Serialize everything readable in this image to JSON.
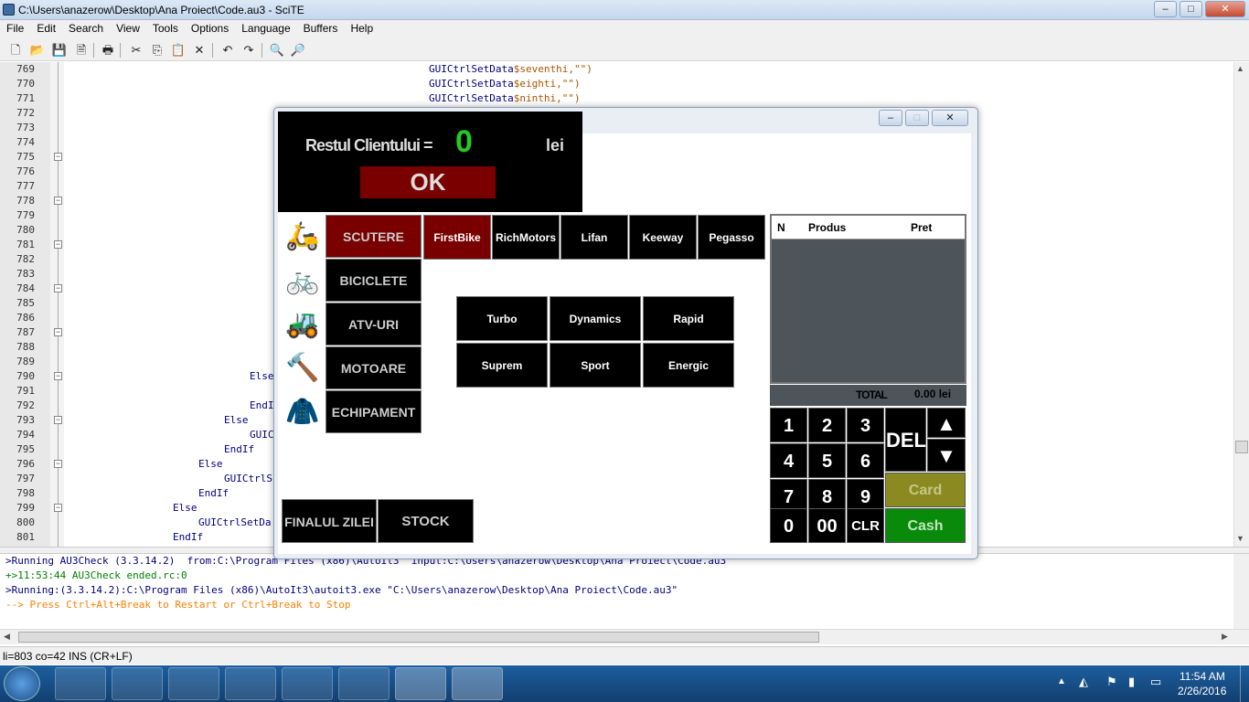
{
  "titlebar": {
    "title": "C:\\Users\\anazerow\\Desktop\\Ana Proiect\\Code.au3 - SciTE",
    "min": "‒",
    "max": "□",
    "close": "✕"
  },
  "menu": [
    "File",
    "Edit",
    "Search",
    "View",
    "Tools",
    "Options",
    "Language",
    "Buffers",
    "Help"
  ],
  "toolbar": {
    "icons": [
      "new-icon",
      "open-icon",
      "save-icon",
      "close-file-icon",
      "print-icon",
      "cut-icon",
      "copy-icon",
      "paste-icon",
      "delete-icon",
      "undo-icon",
      "redo-icon",
      "find-icon",
      "replace-icon"
    ]
  },
  "editor": {
    "lines": [
      "769",
      "770",
      "771",
      "772",
      "773",
      "774",
      "775",
      "776",
      "777",
      "778",
      "779",
      "780",
      "781",
      "782",
      "783",
      "784",
      "785",
      "786",
      "787",
      "788",
      "789",
      "790",
      "791",
      "792",
      "793",
      "794",
      "795",
      "796",
      "797",
      "798",
      "799",
      "800",
      "801"
    ],
    "code": [
      {
        "t": "GUICtrlSetData",
        "a": "$seventhi,\"\")"
      },
      {
        "t": "GUICtrlSetData",
        "a": "$eighti,\"\")"
      },
      {
        "t": "GUICtrlSetData",
        "a": "$ninthi,\"\")"
      }
    ],
    "code2": [
      "Else",
      "EndI",
      "Else",
      "GUIC",
      "EndIf",
      "Else",
      "GUICtrlS",
      "EndIf",
      "Else",
      "GUICtrlSetDa",
      "EndIf"
    ]
  },
  "output": [
    ">Running AU3Check (3.3.14.2)  from:C:\\Program Files (x86)\\AutoIt3  input:C:\\Users\\anazerow\\Desktop\\Ana Proiect\\Code.au3",
    "+>11:53:44 AU3Check ended.rc:0",
    ">Running:(3.3.14.2):C:\\Program Files (x86)\\AutoIt3\\autoit3.exe \"C:\\Users\\anazerow\\Desktop\\Ana Proiect\\Code.au3\"",
    "--> Press Ctrl+Alt+Break to Restart or Ctrl+Break to Stop"
  ],
  "status": "li=803 co=42 INS (CR+LF)",
  "pos": {
    "rest_label": "Restul Clientului =",
    "rest_value": "0",
    "currency": "lei",
    "ok": "OK",
    "categories": [
      "SCUTERE",
      "BICICLETE",
      "ATV-URI",
      "MOTOARE",
      "ECHIPAMENT"
    ],
    "brands": [
      "FirstBike",
      "RichMotors",
      "Lifan",
      "Keeway",
      "Pegasso"
    ],
    "models": [
      "Turbo",
      "Dynamics",
      "Rapid",
      "Suprem",
      "Sport",
      "Energic"
    ],
    "finalul": "FINALUL ZILEI",
    "stock": "STOCK",
    "cart_headers": [
      "N",
      "Produs",
      "Pret"
    ],
    "total_label": "TOTAL",
    "total_value": "0.00 lei",
    "keys": [
      "1",
      "2",
      "3",
      "4",
      "5",
      "6",
      "7",
      "8",
      "9",
      "0",
      "00",
      "CLR"
    ],
    "del": "DEL",
    "card": "Card",
    "cash": "Cash",
    "colors": {
      "red": "#7a0000",
      "green": "#22cc22",
      "card": "#8a8a20",
      "cash": "#0a8a0a"
    }
  },
  "clock": {
    "time": "11:54 AM",
    "date": "2/26/2016"
  }
}
